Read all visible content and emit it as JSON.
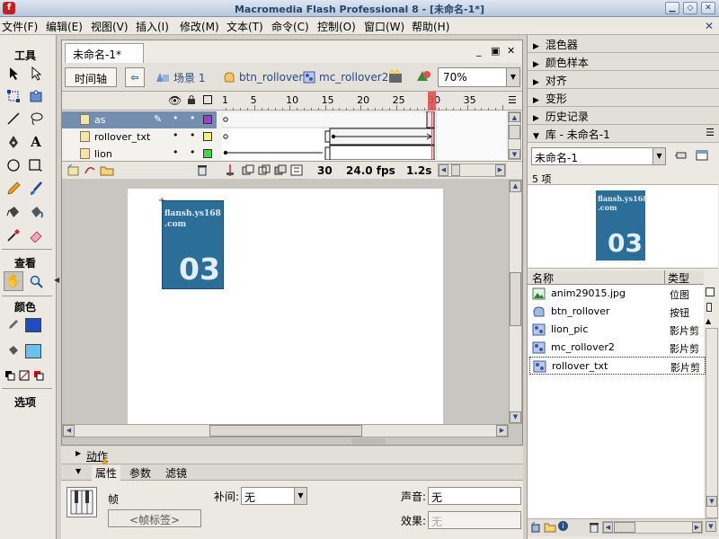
{
  "window": {
    "title": "Macromedia Flash Professional 8 - [未命名-1*]"
  },
  "menu": {
    "items": [
      "文件(F)",
      "编辑(E)",
      "视图(V)",
      "插入(I)",
      "修改(M)",
      "文本(T)",
      "命令(C)",
      "控制(O)",
      "窗口(W)",
      "帮助(H)"
    ]
  },
  "tools": {
    "header": "工具",
    "view_label": "查看",
    "color_label": "颜色",
    "options_label": "选项"
  },
  "document": {
    "tab_title": "未命名-1*",
    "timeline_button": "时间轴",
    "breadcrumbs": [
      "场景 1",
      "btn_rollover",
      "mc_rollover2"
    ],
    "zoom": "70%"
  },
  "timeline": {
    "ruler_numbers": [
      "1",
      "5",
      "10",
      "15",
      "20",
      "25",
      "30",
      "35"
    ],
    "layers": [
      {
        "name": "as",
        "selected": true
      },
      {
        "name": "rollover_txt",
        "selected": false
      },
      {
        "name": "lion",
        "selected": false
      }
    ],
    "current_frame": "30",
    "fps": "24.0 fps",
    "elapsed": "1.2s"
  },
  "stage": {
    "card_text_line1": "flansh.ys168",
    "card_text_line2": ".com",
    "card_number": "03"
  },
  "properties": {
    "actions_tab": "动作",
    "tabs": [
      "属性",
      "参数",
      "滤镜"
    ],
    "frame_label": "帧",
    "frame_label_placeholder": "<帧标签>",
    "tween_label": "补间:",
    "tween_value": "无",
    "sound_label": "声音:",
    "sound_value": "无",
    "effect_label": "效果:",
    "effect_value": "无"
  },
  "panels": {
    "items": [
      "混色器",
      "颜色样本",
      "对齐",
      "变形",
      "历史记录"
    ],
    "library_title": "库 - 未命名-1",
    "library_select": "未命名-1",
    "item_count": "5 项",
    "preview_text_line1": "flansh.ys168",
    "preview_text_line2": ".com",
    "preview_number": "03",
    "col_name": "名称",
    "col_type": "类型",
    "library_items": [
      {
        "name": "anim29015.jpg",
        "type": "位图",
        "icon": "bitmap-icon"
      },
      {
        "name": "btn_rollover",
        "type": "按钮",
        "icon": "button-symbol-icon"
      },
      {
        "name": "lion_pic",
        "type": "影片剪",
        "icon": "movieclip-icon"
      },
      {
        "name": "mc_rollover2",
        "type": "影片剪",
        "icon": "movieclip-icon"
      },
      {
        "name": "rollover_txt",
        "type": "影片剪",
        "icon": "movieclip-icon"
      }
    ]
  },
  "colors": {
    "stroke": "#1f4dbe",
    "fill": "#6cc0ee",
    "card_bg": "#2b6f99",
    "selection": "#738eae",
    "keyframe_playhead": "#e05050"
  }
}
